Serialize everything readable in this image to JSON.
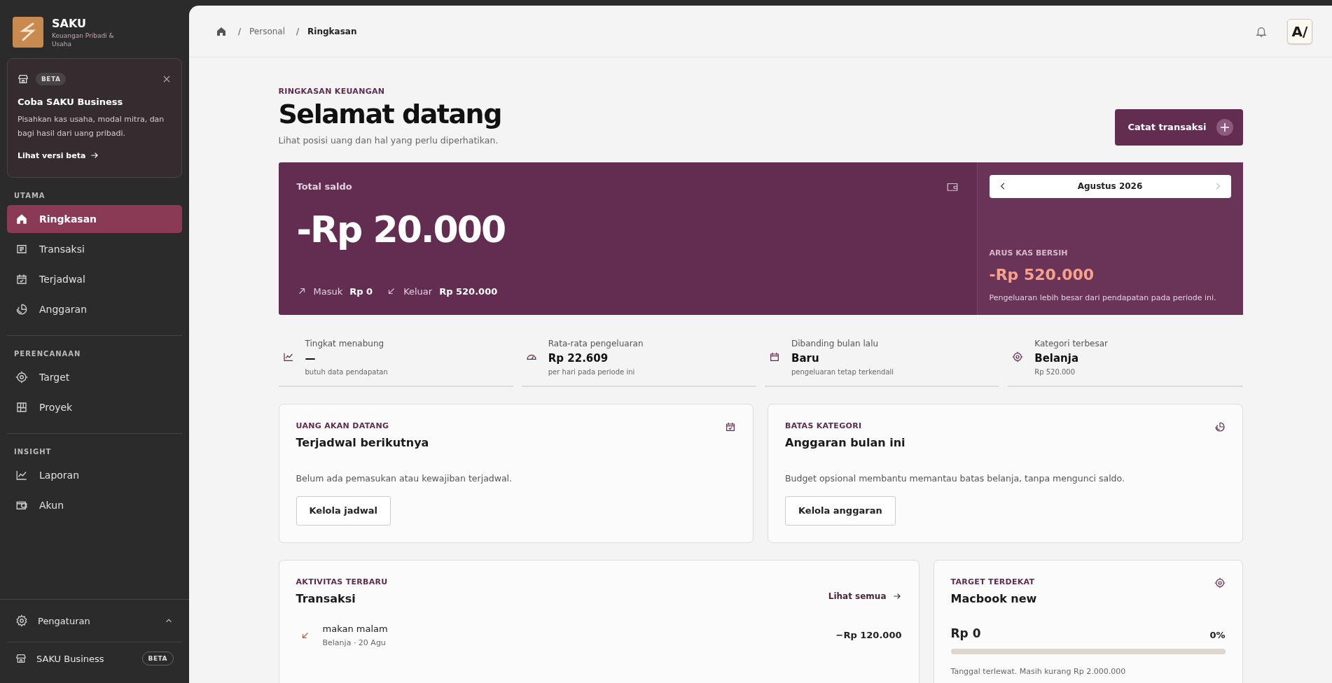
{
  "app": {
    "name": "SAKU",
    "tagline": "Keuangan Pribadi & Usaha"
  },
  "promo": {
    "badge": "BETA",
    "title": "Coba SAKU Business",
    "text": "Pisahkan kas usaha, modal mitra, dan bagi hasil dari uang pribadi.",
    "link": "Lihat versi beta"
  },
  "nav_sections": [
    {
      "label": "UTAMA",
      "items": [
        {
          "label": "Ringkasan",
          "selected": true
        },
        {
          "label": "Transaksi",
          "selected": false
        },
        {
          "label": "Terjadwal",
          "selected": false
        },
        {
          "label": "Anggaran",
          "selected": false
        }
      ]
    },
    {
      "label": "PERENCANAAN",
      "items": [
        {
          "label": "Target",
          "selected": false
        },
        {
          "label": "Proyek",
          "selected": false
        }
      ]
    },
    {
      "label": "INSIGHT",
      "items": [
        {
          "label": "Laporan",
          "selected": false
        },
        {
          "label": "Akun",
          "selected": false
        }
      ]
    }
  ],
  "settings": {
    "label": "Pengaturan",
    "expanded": true
  },
  "business": {
    "label": "SAKU Business",
    "badge": "BETA"
  },
  "breadcrumb": [
    "Personal",
    "Ringkasan"
  ],
  "breadcrumb_separator": "/",
  "avatar": "A/",
  "page": {
    "eyebrow": "RINGKASAN KEUANGAN",
    "title": "Selamat datang",
    "subtitle": "Lihat posisi uang dan hal yang perlu diperhatikan.",
    "button": "Catat transaksi"
  },
  "balance": {
    "label": "Total saldo",
    "amount": "-Rp 20.000",
    "in_label": "Masuk",
    "in_value": "Rp 0",
    "out_label": "Keluar",
    "out_value": "Rp 520.000",
    "month": "Agustus 2026",
    "net_label": "ARUS KAS BERSIH",
    "net_amount": "-Rp 520.000",
    "net_note": "Pengeluaran lebih besar dari pendapatan pada periode ini."
  },
  "stats": [
    {
      "label": "Tingkat menabung",
      "value": "—",
      "note": "butuh data pendapatan"
    },
    {
      "label": "Rata-rata pengeluaran",
      "value": "Rp 22.609",
      "note": "per hari pada periode ini"
    },
    {
      "label": "Dibanding bulan lalu",
      "value": "Baru",
      "note": "pengeluaran tetap terkendali"
    },
    {
      "label": "Kategori terbesar",
      "value": "Belanja",
      "note": "Rp 520.000"
    }
  ],
  "cards": [
    {
      "eyebrow": "UANG AKAN DATANG",
      "title": "Terjadwal berikutnya",
      "text": "Belum ada pemasukan atau kewajiban terjadwal.",
      "button": "Kelola jadwal"
    },
    {
      "eyebrow": "BATAS KATEGORI",
      "title": "Anggaran bulan ini",
      "text": "Budget opsional membantu memantau batas belanja, tanpa mengunci saldo.",
      "button": "Kelola anggaran"
    }
  ],
  "activity": {
    "eyebrow": "AKTIVITAS TERBARU",
    "title": "Transaksi",
    "link": "Lihat semua",
    "transactions": [
      {
        "name": "makan malam",
        "meta": "Belanja · 20 Agu",
        "amount": "−Rp 120.000"
      }
    ]
  },
  "goal": {
    "eyebrow": "TARGET TERDEKAT",
    "title": "Macbook new",
    "amount": "Rp 0",
    "percent": "0%",
    "level": 0,
    "note": "Tanggal terlewat. Masih kurang Rp 2.000.000"
  }
}
